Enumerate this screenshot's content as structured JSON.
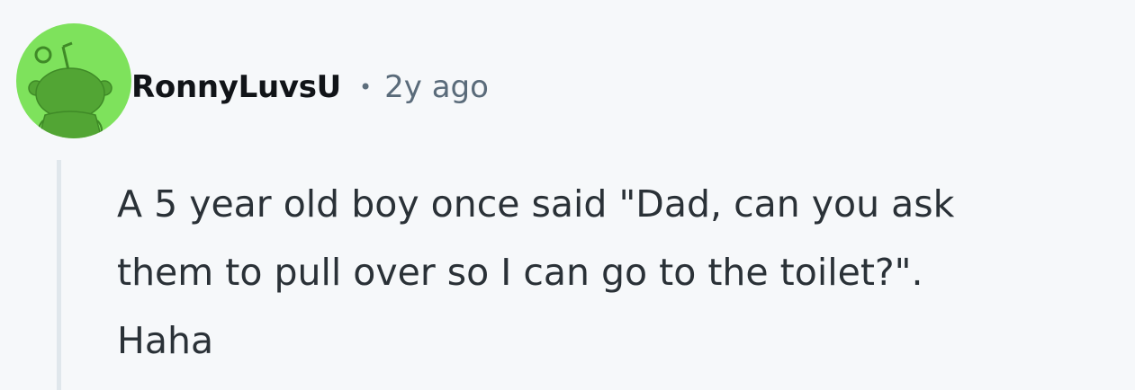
{
  "comment": {
    "author": "RonnyLuvsU",
    "separator": "•",
    "timestamp": "2y ago",
    "body_lines": [
      "A 5 year old boy once said \"Dad, can you ask",
      "them to pull over so I can go to the toilet?\".",
      "Haha"
    ]
  },
  "colors": {
    "avatar_background": "#7ee25c",
    "avatar_figure": "#52a534",
    "page_background": "#f6f8fa",
    "thread_line": "#e0e7ec"
  },
  "icons": {
    "avatar": "snoo-avatar-icon"
  }
}
